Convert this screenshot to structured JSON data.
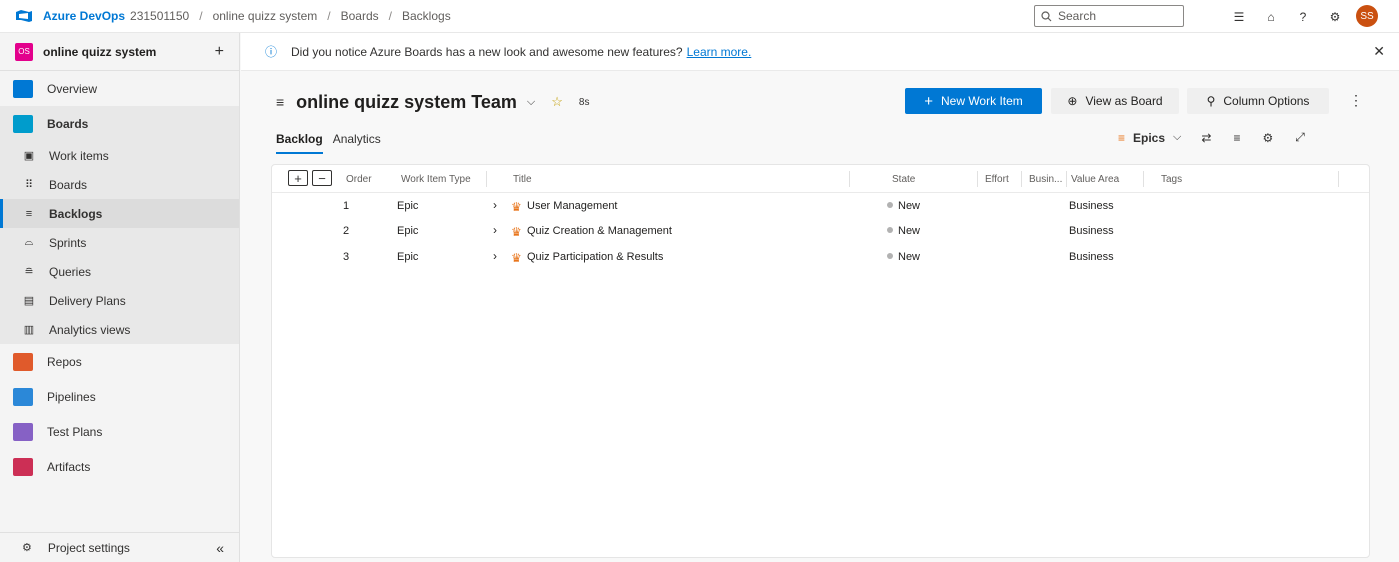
{
  "topbar": {
    "brand": "Azure DevOps",
    "org": "231501150",
    "project": "online quizz system",
    "section": "Boards",
    "page": "Backlogs",
    "search_placeholder": "Search",
    "avatar_initials": "SS",
    "avatar_color": "#ca5010"
  },
  "sidebar": {
    "project_badge": "OS",
    "project_name": "online quizz system",
    "add_label": "+",
    "overview": "Overview",
    "boards": "Boards",
    "sub_items": [
      {
        "label": "Work items",
        "icon": "work-items-icon"
      },
      {
        "label": "Boards",
        "icon": "boards-grid-icon"
      },
      {
        "label": "Backlogs",
        "icon": "backlog-icon"
      },
      {
        "label": "Sprints",
        "icon": "sprints-icon"
      },
      {
        "label": "Queries",
        "icon": "queries-icon"
      },
      {
        "label": "Delivery Plans",
        "icon": "delivery-plans-icon"
      },
      {
        "label": "Analytics views",
        "icon": "analytics-views-icon"
      }
    ],
    "repos": "Repos",
    "pipelines": "Pipelines",
    "test_plans": "Test Plans",
    "artifacts": "Artifacts",
    "project_settings": "Project settings",
    "collapse_glyph": "«"
  },
  "banner": {
    "text": "Did you notice Azure Boards has a new look and awesome new features?",
    "link": "Learn more.",
    "close": "✕"
  },
  "header": {
    "team_name": "online quizz system Team",
    "new_work_item": "New Work Item",
    "view_as_board": "View as Board",
    "column_options": "Column Options"
  },
  "tabs": {
    "backlog": "Backlog",
    "analytics": "Analytics",
    "level": "Epics"
  },
  "grid": {
    "columns": {
      "order": "Order",
      "type": "Work Item Type",
      "title": "Title",
      "state": "State",
      "effort": "Effort",
      "business": "Busin...",
      "value_area": "Value Area",
      "tags": "Tags"
    },
    "rows": [
      {
        "order": "1",
        "type": "Epic",
        "title": "User Management",
        "state": "New",
        "value_area": "Business"
      },
      {
        "order": "2",
        "type": "Epic",
        "title": "Quiz Creation & Management",
        "state": "New",
        "value_area": "Business"
      },
      {
        "order": "3",
        "type": "Epic",
        "title": "Quiz Participation & Results",
        "state": "New",
        "value_area": "Business"
      }
    ]
  },
  "colors": {
    "accent": "#0078d4",
    "epic": "#e8741a",
    "project_badge": "#e3008c"
  }
}
